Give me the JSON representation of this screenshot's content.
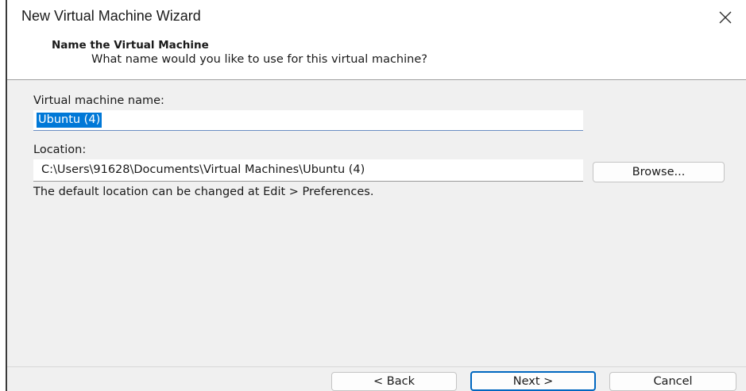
{
  "window": {
    "title": "New Virtual Machine Wizard"
  },
  "header": {
    "title": "Name the Virtual Machine",
    "subtitle": "What name would you like to use for this virtual machine?"
  },
  "form": {
    "name_label": "Virtual machine name:",
    "name_value": "Ubuntu (4)",
    "location_label": "Location:",
    "location_value": "C:\\Users\\91628\\Documents\\Virtual Machines\\Ubuntu (4)",
    "browse_label": "Browse...",
    "hint": "The default location can be changed at Edit > Preferences."
  },
  "footer": {
    "back_label": "< Back",
    "next_label": "Next >",
    "cancel_label": "Cancel"
  },
  "icons": {
    "close": "close-icon"
  },
  "colors": {
    "selection": "#0078d7",
    "primary_border": "#0067c0",
    "dialog_bg": "#f0f0f0"
  }
}
